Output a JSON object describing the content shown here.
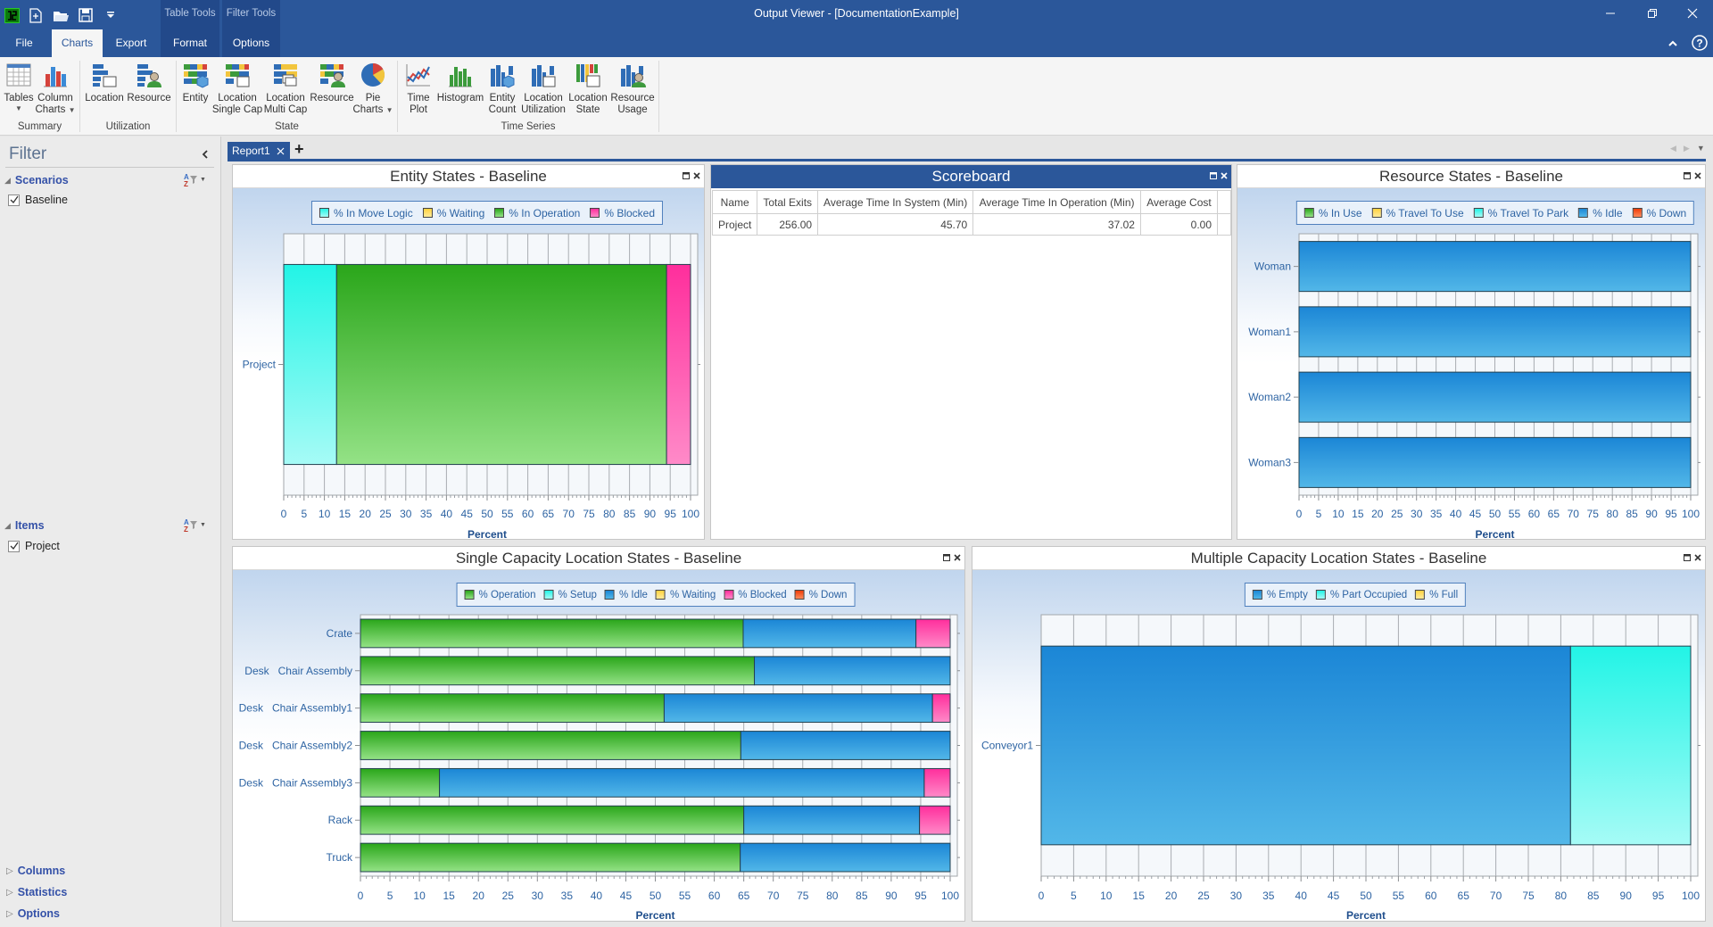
{
  "app": {
    "title": "Output Viewer - [DocumentationExample]"
  },
  "quick_access": {
    "icons": [
      "app-logo-icon",
      "new-document-icon",
      "open-folder-icon",
      "save-icon",
      "customize-quick-access-icon"
    ]
  },
  "tabs": {
    "contextual": [
      {
        "label": "Table Tools"
      },
      {
        "label": "Filter Tools"
      }
    ],
    "items": [
      {
        "label": "File"
      },
      {
        "label": "Charts",
        "active": true
      },
      {
        "label": "Export"
      },
      {
        "label": "Format"
      },
      {
        "label": "Options"
      }
    ]
  },
  "window_controls": [
    "minimize-icon",
    "restore-icon",
    "close-icon"
  ],
  "ribbon": {
    "groups": [
      {
        "label": "Summary",
        "items": [
          {
            "label": "Tables",
            "dropdown": true,
            "icon": "table-icon"
          },
          {
            "label": "Column\nCharts",
            "dropdown": true,
            "icon": "column-chart-icon"
          }
        ]
      },
      {
        "label": "Utilization",
        "items": [
          {
            "label": "Location",
            "icon": "location-utilization-icon"
          },
          {
            "label": "Resource",
            "icon": "resource-utilization-icon"
          }
        ]
      },
      {
        "label": "State",
        "items": [
          {
            "label": "Entity",
            "icon": "entity-state-icon"
          },
          {
            "label": "Location\nSingle Cap",
            "icon": "location-single-cap-icon"
          },
          {
            "label": "Location\nMulti Cap",
            "icon": "location-multi-cap-icon"
          },
          {
            "label": "Resource",
            "icon": "resource-state-icon"
          },
          {
            "label": "Pie\nCharts",
            "dropdown": true,
            "icon": "pie-chart-icon"
          }
        ]
      },
      {
        "label": "Time Series",
        "items": [
          {
            "label": "Time\nPlot",
            "icon": "time-plot-icon"
          },
          {
            "label": "Histogram",
            "icon": "histogram-icon"
          },
          {
            "label": "Entity\nCount",
            "icon": "entity-count-icon"
          },
          {
            "label": "Location\nUtilization",
            "icon": "location-utilization-ts-icon"
          },
          {
            "label": "Location\nState",
            "icon": "location-state-ts-icon"
          },
          {
            "label": "Resource\nUsage",
            "icon": "resource-usage-icon"
          }
        ]
      }
    ]
  },
  "sidebar": {
    "title": "Filter",
    "sections": [
      {
        "label": "Scenarios",
        "expanded": true,
        "items": [
          {
            "label": "Baseline",
            "checked": true
          }
        ]
      },
      {
        "label": "Items",
        "expanded": true,
        "items": [
          {
            "label": "Project",
            "checked": true
          }
        ]
      }
    ],
    "collapsed_sections": [
      {
        "label": "Columns"
      },
      {
        "label": "Statistics"
      },
      {
        "label": "Options"
      }
    ]
  },
  "documents": {
    "tabs": [
      {
        "label": "Report1"
      }
    ],
    "add_label": "+"
  },
  "scoreboard": {
    "title": "Scoreboard",
    "columns": [
      "Name",
      "Total Exits",
      "Average Time In System (Min)",
      "Average Time In Operation (Min)",
      "Average Cost"
    ],
    "rows": [
      [
        "Project",
        "256.00",
        "45.70",
        "37.02",
        "0.00"
      ]
    ]
  },
  "chart_data": [
    {
      "id": "entity",
      "type": "bar",
      "orientation": "horizontal",
      "stacked": true,
      "title": "Entity States - Baseline",
      "xlabel": "Percent",
      "ylabel": "",
      "xlim": [
        0,
        100
      ],
      "xticks": [
        0,
        5,
        10,
        15,
        20,
        25,
        30,
        35,
        40,
        45,
        50,
        55,
        60,
        65,
        70,
        75,
        80,
        85,
        90,
        95,
        100
      ],
      "grid": true,
      "legend": "top",
      "categories": [
        "Project"
      ],
      "series": [
        {
          "name": "% In Move Logic",
          "color": "#22f4e6",
          "color_light": "#a6fbf6",
          "values": [
            13.0
          ]
        },
        {
          "name": "% Waiting",
          "color": "#ffd23f",
          "color_light": "#ffeb9a",
          "values": [
            0
          ]
        },
        {
          "name": "% In Operation",
          "color": "#2aa61a",
          "color_light": "#94e286",
          "values": [
            81.1
          ]
        },
        {
          "name": "% Blocked",
          "color": "#ff2e9c",
          "color_light": "#ff8ac8",
          "values": [
            5.9
          ]
        }
      ]
    },
    {
      "id": "resource",
      "type": "bar",
      "orientation": "horizontal",
      "stacked": true,
      "title": "Resource States - Baseline",
      "xlabel": "Percent",
      "ylabel": "",
      "xlim": [
        0,
        100
      ],
      "xticks": [
        0,
        5,
        10,
        15,
        20,
        25,
        30,
        35,
        40,
        45,
        50,
        55,
        60,
        65,
        70,
        75,
        80,
        85,
        90,
        95,
        100
      ],
      "grid": true,
      "legend": "top",
      "categories": [
        "Woman",
        "Woman1",
        "Woman2",
        "Woman3"
      ],
      "series": [
        {
          "name": "% In Use",
          "color": "#2aa61a",
          "color_light": "#94e286",
          "values": [
            0,
            0,
            0,
            0
          ]
        },
        {
          "name": "% Travel To Use",
          "color": "#ffd23f",
          "color_light": "#ffeb9a",
          "values": [
            0,
            0,
            0,
            0
          ]
        },
        {
          "name": "% Travel To Park",
          "color": "#22f4e6",
          "color_light": "#a6fbf6",
          "values": [
            0,
            0,
            0,
            0
          ]
        },
        {
          "name": "% Idle",
          "color": "#1b86d6",
          "color_light": "#52b7e8",
          "values": [
            100,
            100,
            100,
            100
          ]
        },
        {
          "name": "% Down",
          "color": "#ee3d08",
          "color_light": "#ff8a5a",
          "values": [
            0,
            0,
            0,
            0
          ]
        }
      ]
    },
    {
      "id": "single",
      "type": "bar",
      "orientation": "horizontal",
      "stacked": true,
      "title": "Single Capacity Location States - Baseline",
      "xlabel": "Percent",
      "ylabel": "",
      "xlim": [
        0,
        100
      ],
      "xticks": [
        0,
        5,
        10,
        15,
        20,
        25,
        30,
        35,
        40,
        45,
        50,
        55,
        60,
        65,
        70,
        75,
        80,
        85,
        90,
        95,
        100
      ],
      "grid": true,
      "legend": "top",
      "categories": [
        "Crate",
        "Desk   Chair Assembly",
        "Desk   Chair Assembly1",
        "Desk   Chair Assembly2",
        "Desk   Chair Assembly3",
        "Rack",
        "Truck"
      ],
      "series": [
        {
          "name": "% Operation",
          "color": "#2aa61a",
          "color_light": "#94e286",
          "values": [
            64.9,
            66.8,
            51.5,
            64.5,
            13.4,
            65.0,
            64.4
          ]
        },
        {
          "name": "% Setup",
          "color": "#22f4e6",
          "color_light": "#a6fbf6",
          "values": [
            0,
            0,
            0,
            0,
            0,
            0,
            0
          ]
        },
        {
          "name": "% Idle",
          "color": "#1b86d6",
          "color_light": "#52b7e8",
          "values": [
            29.3,
            33.2,
            45.5,
            35.5,
            82.2,
            29.8,
            35.6
          ]
        },
        {
          "name": "% Waiting",
          "color": "#ffd23f",
          "color_light": "#ffeb9a",
          "values": [
            0,
            0,
            0,
            0,
            0,
            0,
            0
          ]
        },
        {
          "name": "% Blocked",
          "color": "#ff2e9c",
          "color_light": "#ff8ac8",
          "values": [
            5.8,
            0,
            3.0,
            0,
            4.4,
            5.2,
            0
          ]
        },
        {
          "name": "% Down",
          "color": "#ee3d08",
          "color_light": "#ff8a5a",
          "values": [
            0,
            0,
            0,
            0,
            0,
            0,
            0
          ]
        }
      ]
    },
    {
      "id": "multi",
      "type": "bar",
      "orientation": "horizontal",
      "stacked": true,
      "title": "Multiple Capacity Location States - Baseline",
      "xlabel": "Percent",
      "ylabel": "",
      "xlim": [
        0,
        100
      ],
      "xticks": [
        0,
        5,
        10,
        15,
        20,
        25,
        30,
        35,
        40,
        45,
        50,
        55,
        60,
        65,
        70,
        75,
        80,
        85,
        90,
        95,
        100
      ],
      "grid": true,
      "legend": "top",
      "categories": [
        "Conveyor1"
      ],
      "series": [
        {
          "name": "% Empty",
          "color": "#1b86d6",
          "color_light": "#52b7e8",
          "values": [
            81.5
          ]
        },
        {
          "name": "% Part Occupied",
          "color": "#22f4e6",
          "color_light": "#a6fbf6",
          "values": [
            18.5
          ]
        },
        {
          "name": "% Full",
          "color": "#ffd23f",
          "color_light": "#ffeb9a",
          "values": [
            0
          ]
        }
      ]
    }
  ]
}
